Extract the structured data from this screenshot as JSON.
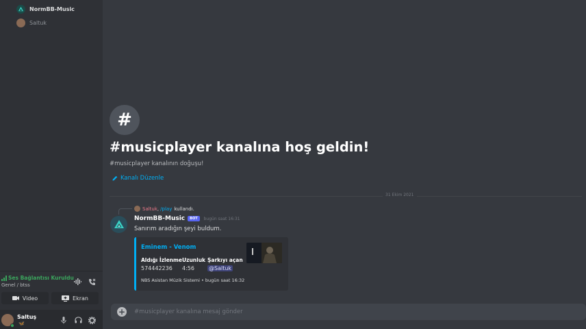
{
  "voice_channel": {
    "users": [
      {
        "name": "NormBB-Music"
      },
      {
        "name": "Saltuk"
      }
    ]
  },
  "voice_panel": {
    "status": "Ses Bağlantısı Kuruldu",
    "channel": "Genel / btss",
    "video_label": "Video",
    "screen_label": "Ekran"
  },
  "user_panel": {
    "username": "Saltuş",
    "tag": "🦋"
  },
  "channel": {
    "welcome_title": "#musicplayer kanalına hoş geldin!",
    "welcome_subtitle": "#musicplayer kanalının doğuşu!",
    "edit_label": "Kanalı Düzenle"
  },
  "date_divider": "31 Ekim 2021",
  "message": {
    "reply": {
      "user": "Saltuk",
      "separator": ",",
      "command": "/play",
      "text": "kullandı."
    },
    "author": "NormBB-Music",
    "badge": "BOT",
    "timestamp": "bugün saat 16:31",
    "text": "Sanırım aradığın şeyi buldum.",
    "embed": {
      "title": "Eminem - Venom",
      "fields": [
        {
          "name": "Aldığı İzlenme",
          "value": "574442236"
        },
        {
          "name": "Uzunluk",
          "value": "4:56"
        },
        {
          "name": "Şarkıyı açan",
          "value": "@Saltuk"
        }
      ],
      "footer": "NBS Asistan Müzik Sistemi • bugün saat 16:32",
      "accent_color": "#00aff4"
    }
  },
  "input": {
    "placeholder": "#musicplayer kanalına mesaj gönder"
  },
  "colors": {
    "background": "#36393f",
    "sidebar": "#2f3136",
    "voice_connected": "#3ba55d",
    "link": "#00aff4",
    "bot_badge": "#5865f2"
  }
}
